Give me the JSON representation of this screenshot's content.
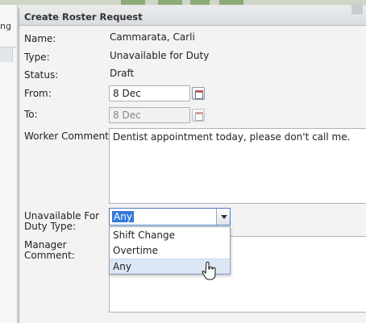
{
  "background": {
    "left_fragment": "ng"
  },
  "dialog": {
    "title": "Create Roster Request",
    "name_label": "Name:",
    "name_value": "Cammarata, Carli",
    "type_label": "Type:",
    "type_value": "Unavailable for Duty",
    "status_label": "Status:",
    "status_value": "Draft",
    "from_label": "From:",
    "from_value": "8 Dec",
    "to_label": "To:",
    "to_value": "8 Dec",
    "worker_comment_label": "Worker Comment:",
    "worker_comment_value": "Dentist appointment today, please don't call me.",
    "unavailable_type_label_line1": "Unavailable For",
    "unavailable_type_label_line2": "Duty Type:",
    "unavailable_type_value": "Any",
    "manager_comment_label_line1": "Manager",
    "manager_comment_label_line2": "Comment:",
    "dropdown_options": [
      "Shift Change",
      "Overtime",
      "Any"
    ]
  },
  "colors": {
    "selection": "#3778d7",
    "hover_option": "#dde8f6",
    "title_bar": "#d9dcdf"
  }
}
